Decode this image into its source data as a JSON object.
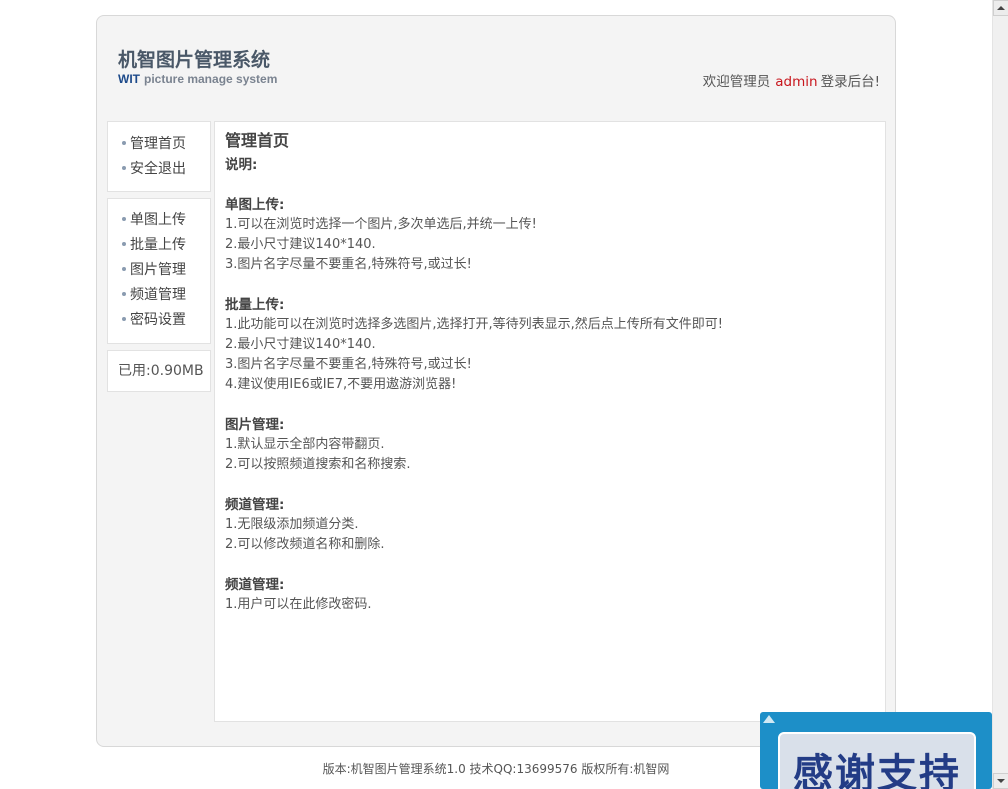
{
  "header": {
    "title": "机智图片管理系统",
    "subtitle_brand": "WIT",
    "subtitle_text": "picture manage system",
    "welcome_prefix": "欢迎管理员",
    "username": "admin",
    "welcome_suffix": "登录后台!"
  },
  "sidebar": {
    "group1": [
      {
        "label": "管理首页"
      },
      {
        "label": "安全退出"
      }
    ],
    "group2": [
      {
        "label": "单图上传"
      },
      {
        "label": "批量上传"
      },
      {
        "label": "图片管理"
      },
      {
        "label": "频道管理"
      },
      {
        "label": "密码设置"
      }
    ],
    "usage": "已用:0.90MB"
  },
  "main": {
    "title": "管理首页",
    "intro": "说明:",
    "sections": [
      {
        "title": "单图上传:",
        "lines": [
          "1.可以在浏览时选择一个图片,多次单选后,并统一上传!",
          "2.最小尺寸建议140*140.",
          "3.图片名字尽量不要重名,特殊符号,或过长!"
        ]
      },
      {
        "title": "批量上传:",
        "lines": [
          "1.此功能可以在浏览时选择多选图片,选择打开,等待列表显示,然后点上传所有文件即可!",
          "2.最小尺寸建议140*140.",
          "3.图片名字尽量不要重名,特殊符号,或过长!",
          "4.建议使用IE6或IE7,不要用遨游浏览器!"
        ]
      },
      {
        "title": "图片管理:",
        "lines": [
          "1.默认显示全部内容带翻页.",
          "2.可以按照频道搜索和名称搜索."
        ]
      },
      {
        "title": "频道管理:",
        "lines": [
          "1.无限级添加频道分类.",
          "2.可以修改频道名称和删除."
        ]
      },
      {
        "title": "频道管理:",
        "lines": [
          "1.用户可以在此修改密码."
        ]
      }
    ]
  },
  "footer": {
    "text": "版本:机智图片管理系统1.0 技术QQ:13699576 版权所有:机智网"
  },
  "badge": {
    "text": "感谢支持"
  },
  "colors": {
    "accent_red": "#c8161d",
    "brand_blue": "#1d4a8a",
    "badge_blue": "#1d8fc8"
  }
}
